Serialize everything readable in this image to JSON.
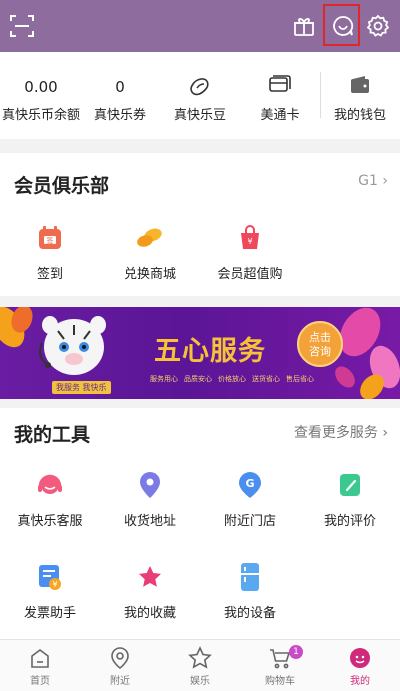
{
  "wallet": {
    "items": [
      {
        "value": "0.00",
        "label": "真快乐币余额"
      },
      {
        "value": "0",
        "label": "真快乐券"
      },
      {
        "label": "真快乐豆",
        "icon": "bean-icon"
      },
      {
        "label": "美通卡",
        "icon": "card-icon"
      },
      {
        "label": "我的钱包",
        "icon": "wallet-icon"
      }
    ]
  },
  "club": {
    "title": "会员俱乐部",
    "level": "G1",
    "items": [
      {
        "label": "签到",
        "icon": "calendar-icon"
      },
      {
        "label": "兑换商城",
        "icon": "beans-icon"
      },
      {
        "label": "会员超值购",
        "icon": "shopping-bag-icon"
      }
    ]
  },
  "banner": {
    "title": "五心服务",
    "button": "点击\n咨询",
    "tags": [
      "服务用心",
      "品质安心",
      "价格放心",
      "送货省心",
      "售后省心"
    ],
    "slogan": "我服务 我快乐"
  },
  "tools": {
    "title": "我的工具",
    "more": "查看更多服务",
    "items": [
      {
        "label": "真快乐客服",
        "icon": "headset-icon"
      },
      {
        "label": "收货地址",
        "icon": "location-pin-icon"
      },
      {
        "label": "附近门店",
        "icon": "store-map-icon"
      },
      {
        "label": "我的评价",
        "icon": "review-icon"
      },
      {
        "label": "发票助手",
        "icon": "invoice-icon"
      },
      {
        "label": "我的收藏",
        "icon": "star-icon"
      },
      {
        "label": "我的设备",
        "icon": "fridge-icon"
      }
    ]
  },
  "tabbar": {
    "items": [
      {
        "label": "首页",
        "icon": "home-icon"
      },
      {
        "label": "附近",
        "icon": "location-icon"
      },
      {
        "label": "娱乐",
        "icon": "star-outline-icon"
      },
      {
        "label": "购物车",
        "icon": "cart-icon",
        "badge": "1"
      },
      {
        "label": "我的",
        "icon": "profile-icon",
        "active": true
      }
    ]
  },
  "colors": {
    "header": "#8e6c9e",
    "accent": "#d0287b",
    "banner": "#5b1596"
  }
}
